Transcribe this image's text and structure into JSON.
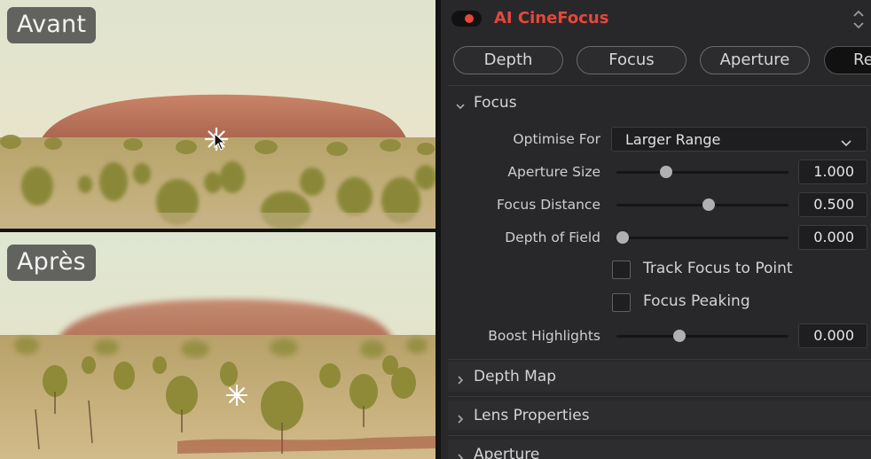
{
  "comparison": {
    "before_label": "Avant",
    "after_label": "Après"
  },
  "effect": {
    "title": "AI CineFocus",
    "enabled": true,
    "accent_color": "#e5473b"
  },
  "tabs": [
    {
      "label": "Depth",
      "active": false
    },
    {
      "label": "Focus",
      "active": false
    },
    {
      "label": "Aperture",
      "active": false
    },
    {
      "label": "Re",
      "active": true
    }
  ],
  "focus_section": {
    "title": "Focus",
    "expanded": true,
    "optimise_for": {
      "label": "Optimise For",
      "value": "Larger Range"
    },
    "aperture_size": {
      "label": "Aperture Size",
      "value": "1.000",
      "slider_fraction": 0.25
    },
    "focus_distance": {
      "label": "Focus Distance",
      "value": "0.500",
      "slider_fraction": 0.5
    },
    "depth_of_field": {
      "label": "Depth of Field",
      "value": "0.000",
      "slider_fraction": 0.0
    },
    "track_focus": {
      "label": "Track Focus to Point",
      "checked": false
    },
    "focus_peaking": {
      "label": "Focus Peaking",
      "checked": false
    },
    "boost_highlights": {
      "label": "Boost Highlights",
      "value": "0.000",
      "slider_fraction": 0.33
    }
  },
  "collapsed_sections": [
    {
      "title": "Depth Map"
    },
    {
      "title": "Lens Properties"
    },
    {
      "title": "Aperture"
    }
  ],
  "icons": {
    "focus_point": "asterisk-crosshair-icon",
    "cursor": "arrow-cursor-icon",
    "section_expanded": "chevron-down-icon",
    "section_collapsed": "chevron-right-icon",
    "dropdown": "chevron-down-icon",
    "scroll": "up-down-arrows-icon"
  }
}
